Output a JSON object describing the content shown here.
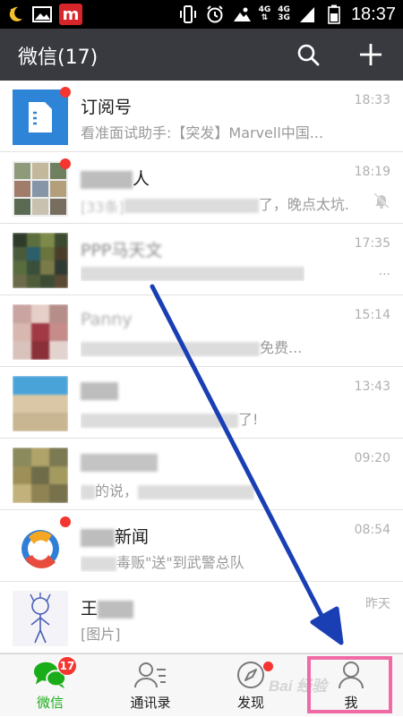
{
  "status_bar": {
    "network_top": "4G",
    "network_mid": "4G",
    "network_bottom": "3G",
    "time": "18:37",
    "app_badge": "m"
  },
  "header": {
    "title": "微信(17)",
    "search_icon": "search-icon",
    "add_icon": "plus-icon"
  },
  "chats": [
    {
      "name": "订阅号",
      "message": "看准面试助手:【突发】Marvell中国...",
      "time": "18:33",
      "unread": true
    },
    {
      "name_visible": "人",
      "message_visible": "了，晚点太坑...",
      "message_prefix": "[33条]",
      "time": "18:19",
      "muted": true,
      "unread": true
    },
    {
      "name_visible": "PPP马天文",
      "message_visible": "...",
      "time": "17:35"
    },
    {
      "name_visible": "Panny",
      "message_visible": "免费...",
      "time": "15:14"
    },
    {
      "name_visible": "",
      "message_visible": "了!",
      "time": "13:43"
    },
    {
      "name_visible": "",
      "message_visible": "的说，",
      "time": "09:20"
    },
    {
      "name_visible": "新闻",
      "message_visible": "毒贩\"送\"到武警总队",
      "time": "08:54",
      "unread": true
    },
    {
      "name_visible": "王",
      "message_visible": "[图片]",
      "time": "昨天"
    }
  ],
  "tabbar": {
    "tabs": [
      {
        "label": "微信",
        "icon": "chat-bubbles-icon",
        "badge": "17",
        "active": true
      },
      {
        "label": "通讯录",
        "icon": "contacts-icon"
      },
      {
        "label": "发现",
        "icon": "compass-icon",
        "dot": true
      },
      {
        "label": "我",
        "icon": "person-icon",
        "highlighted": true
      }
    ]
  },
  "colors": {
    "header_bg": "#393a3f",
    "accent_green": "#1aad19",
    "badge_red": "#f43530",
    "annotation_arrow": "#1a3fb5",
    "annotation_box": "#f06aa6"
  },
  "watermark": "Bai  经验"
}
